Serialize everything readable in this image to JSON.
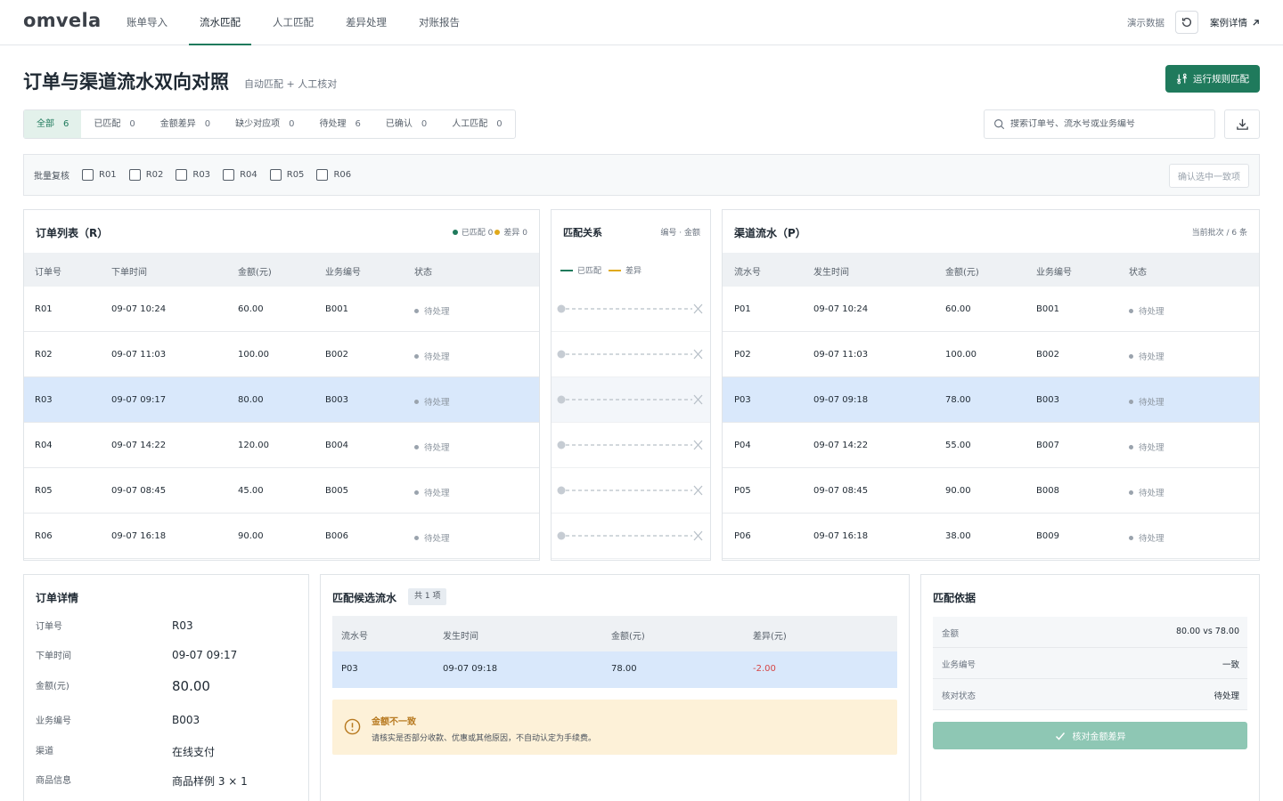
{
  "app": {
    "logo": "omvela"
  },
  "nav": [
    "账单导入",
    "流水匹配",
    "人工匹配",
    "差异处理",
    "对账报告"
  ],
  "topbar": {
    "demo": "演示数据",
    "case_link": "案例详情"
  },
  "header": {
    "title": "订单与渠道流水双向对照",
    "subtitle": "自动匹配 + 人工核对",
    "run_button": "运行规则匹配"
  },
  "filters": [
    {
      "label": "全部",
      "count": "6"
    },
    {
      "label": "已匹配",
      "count": "0"
    },
    {
      "label": "金额差异",
      "count": "0"
    },
    {
      "label": "缺少对应项",
      "count": "0"
    },
    {
      "label": "待处理",
      "count": "6"
    },
    {
      "label": "已确认",
      "count": "0"
    },
    {
      "label": "人工匹配",
      "count": "0"
    }
  ],
  "search": {
    "placeholder": "搜索订单号、流水号或业务编号"
  },
  "batch": {
    "label": "批量复核",
    "items": [
      "R01",
      "R02",
      "R03",
      "R04",
      "R05",
      "R06"
    ],
    "confirm": "确认选中一致项"
  },
  "orders": {
    "title": "订单列表（R）",
    "legend_matched": "已匹配 0",
    "legend_diff": "差异 0",
    "headers": [
      "订单号",
      "下单时间",
      "金额(元)",
      "业务编号",
      "状态"
    ],
    "rows": [
      {
        "id": "R01",
        "time": "09-07 10:24",
        "amount": "60.00",
        "biz": "B001",
        "status": "待处理"
      },
      {
        "id": "R02",
        "time": "09-07 11:03",
        "amount": "100.00",
        "biz": "B002",
        "status": "待处理"
      },
      {
        "id": "R03",
        "time": "09-07 09:17",
        "amount": "80.00",
        "biz": "B003",
        "status": "待处理"
      },
      {
        "id": "R04",
        "time": "09-07 14:22",
        "amount": "120.00",
        "biz": "B004",
        "status": "待处理"
      },
      {
        "id": "R05",
        "time": "09-07 08:45",
        "amount": "45.00",
        "biz": "B005",
        "status": "待处理"
      },
      {
        "id": "R06",
        "time": "09-07 16:18",
        "amount": "90.00",
        "biz": "B006",
        "status": "待处理"
      }
    ]
  },
  "relation": {
    "title": "匹配关系",
    "hint": "编号 · 金额",
    "legend_matched": "已匹配",
    "legend_diff": "差异"
  },
  "flows": {
    "title": "渠道流水（P）",
    "batch_info": "当前批次 / 6 条",
    "headers": [
      "流水号",
      "发生时间",
      "金额(元)",
      "业务编号",
      "状态"
    ],
    "rows": [
      {
        "id": "P01",
        "time": "09-07 10:24",
        "amount": "60.00",
        "biz": "B001",
        "status": "待处理"
      },
      {
        "id": "P02",
        "time": "09-07 11:03",
        "amount": "100.00",
        "biz": "B002",
        "status": "待处理"
      },
      {
        "id": "P03",
        "time": "09-07 09:18",
        "amount": "78.00",
        "biz": "B003",
        "status": "待处理"
      },
      {
        "id": "P04",
        "time": "09-07 14:22",
        "amount": "55.00",
        "biz": "B007",
        "status": "待处理"
      },
      {
        "id": "P05",
        "time": "09-07 08:45",
        "amount": "90.00",
        "biz": "B008",
        "status": "待处理"
      },
      {
        "id": "P06",
        "time": "09-07 16:18",
        "amount": "38.00",
        "biz": "B009",
        "status": "待处理"
      }
    ]
  },
  "detail": {
    "title": "订单详情",
    "fields": [
      {
        "label": "订单号",
        "value": "R03"
      },
      {
        "label": "下单时间",
        "value": "09-07 09:17"
      },
      {
        "label": "金额(元)",
        "value": "80.00"
      },
      {
        "label": "业务编号",
        "value": "B003"
      },
      {
        "label": "渠道",
        "value": "在线支付"
      },
      {
        "label": "商品信息",
        "value": "商品样例 3 × 1"
      }
    ]
  },
  "candidates": {
    "title": "匹配候选流水",
    "badge": "共 1 项",
    "headers": [
      "流水号",
      "发生时间",
      "金额(元)",
      "差异(元)"
    ],
    "row": {
      "id": "P03",
      "time": "09-07 09:18",
      "amount": "78.00",
      "diff": "-2.00"
    },
    "warning_title": "金额不一致",
    "warning_text": "请核实是否部分收款、优惠或其他原因，不自动认定为手续费。"
  },
  "basis": {
    "title": "匹配依据",
    "items": [
      {
        "label": "金额",
        "value": "80.00 vs 78.00"
      },
      {
        "label": "业务编号",
        "value": "一致"
      },
      {
        "label": "核对状态",
        "value": "待处理"
      }
    ],
    "button": "核对金额差异"
  },
  "colors": {
    "accent": "#1f7a5c",
    "selected_row": "#d9e8fb",
    "diff_red": "#d64545",
    "warning_bg": "#fdf1d8",
    "legend_diff": "#e0a91b"
  }
}
